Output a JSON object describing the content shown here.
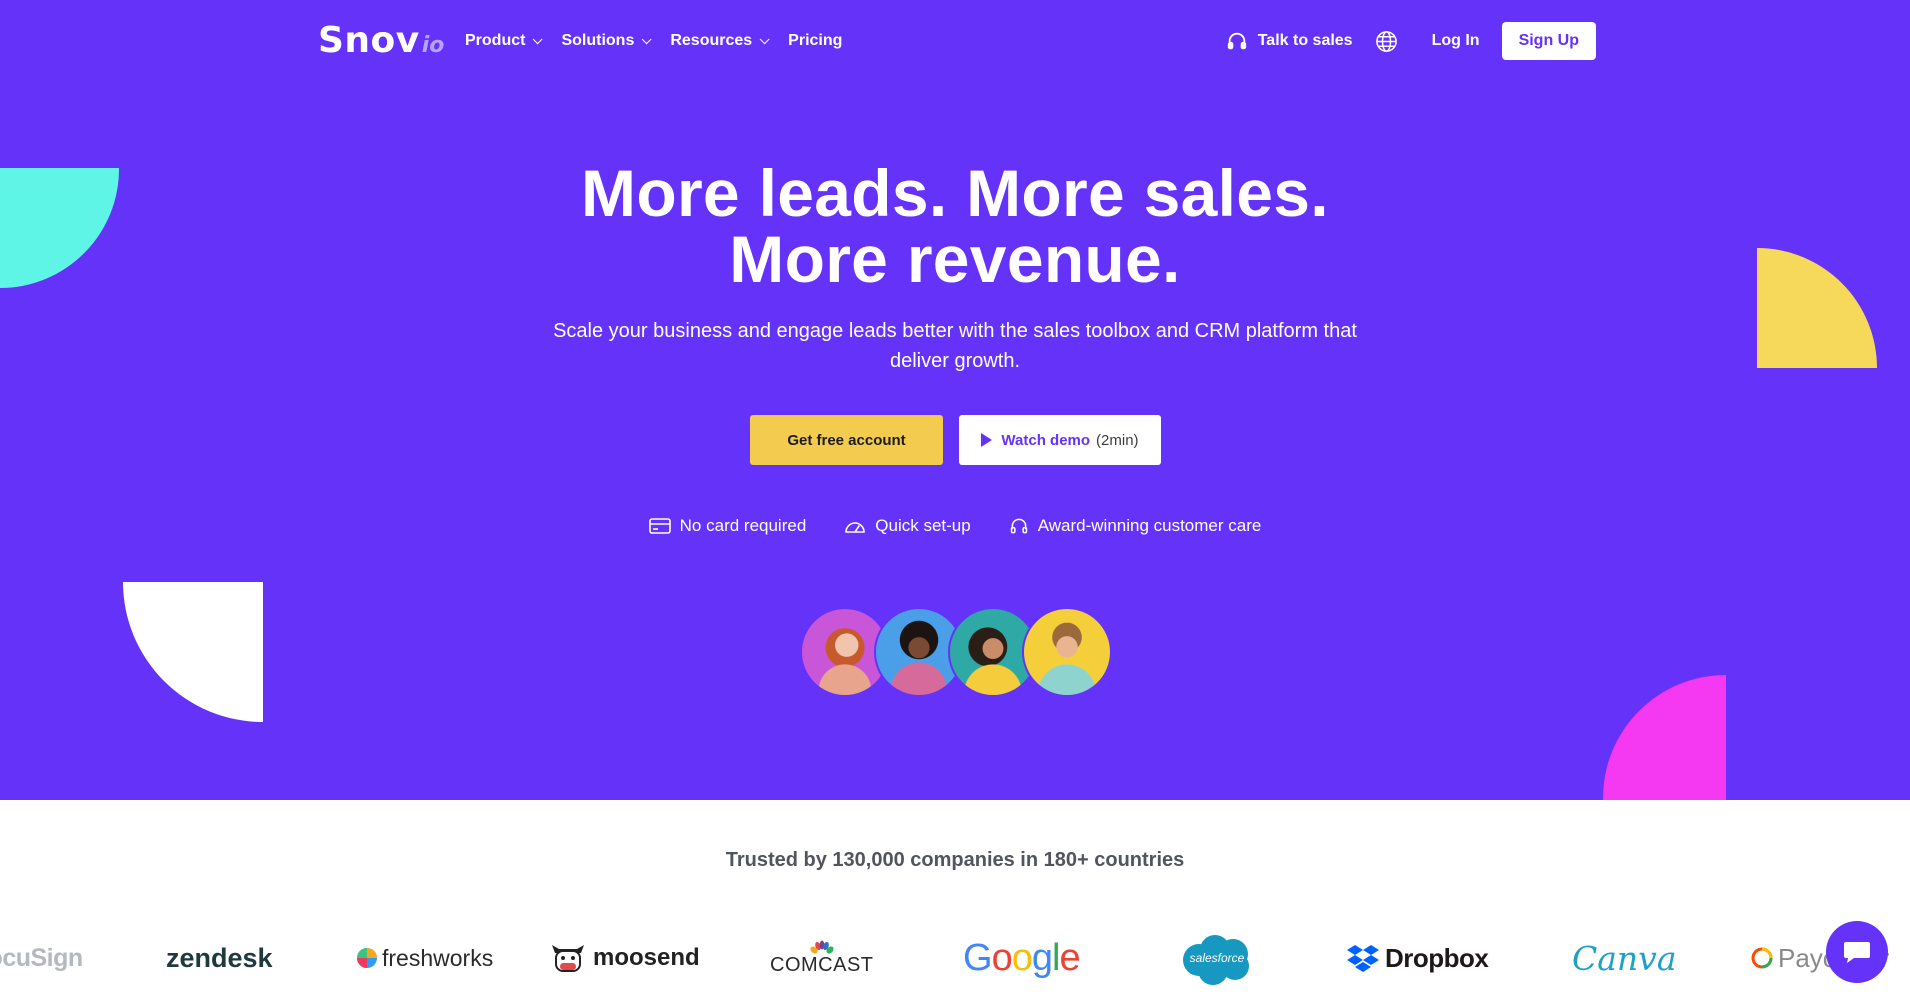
{
  "nav": {
    "logo_main": "Snov",
    "logo_sub": "io",
    "menu": [
      {
        "label": "Product",
        "dropdown": true
      },
      {
        "label": "Solutions",
        "dropdown": true
      },
      {
        "label": "Resources",
        "dropdown": true
      },
      {
        "label": "Pricing",
        "dropdown": false
      }
    ],
    "talk_to_sales": "Talk to sales",
    "login": "Log In",
    "signup": "Sign Up"
  },
  "hero": {
    "headline_line1": "More leads. More sales.",
    "headline_line2": "More revenue.",
    "subtext": "Scale your business and engage leads better with the sales toolbox and CRM platform that deliver growth.",
    "cta_primary": "Get free account",
    "cta_secondary": "Watch demo",
    "cta_secondary_duration": "(2min)",
    "features": [
      {
        "icon": "credit-card-icon",
        "label": "No card required"
      },
      {
        "icon": "speedometer-icon",
        "label": "Quick set-up"
      },
      {
        "icon": "headset-icon",
        "label": "Award-winning customer care"
      }
    ]
  },
  "trust": {
    "heading": "Trusted by 130,000 companies in 180+ countries",
    "brands": [
      "DocuSign",
      "zendesk",
      "freshworks",
      "moosend",
      "COMCAST",
      "Google",
      "salesforce",
      "Dropbox",
      "Canva",
      "Payoneer"
    ]
  },
  "colors": {
    "hero_bg": "#6432f9",
    "cta_yellow": "#f3cb4f",
    "teal": "#5ff5e6",
    "yellow": "#f6d85a",
    "magenta": "#f538f1"
  }
}
